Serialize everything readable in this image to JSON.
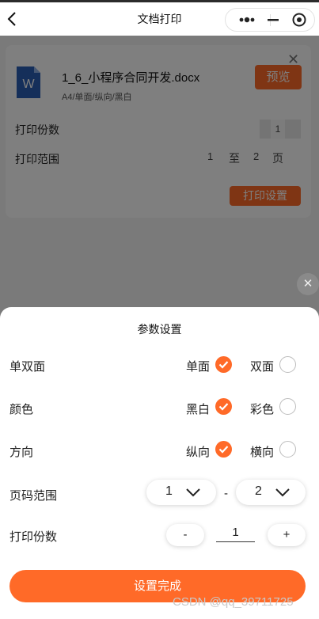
{
  "navbar": {
    "title": "文档打印",
    "back_icon": "chevron-left-icon"
  },
  "capsule": {
    "more_icon": "more-dots-icon",
    "minimize_icon": "minus-icon",
    "close_icon": "target-circle-icon"
  },
  "file_card": {
    "file_name": "1_6_小程序合同开发.docx",
    "meta": "A4/单面/纵向/黑白",
    "preview_label": "预览",
    "copies_label": "打印份数",
    "copies_value": "1",
    "range_label": "打印范围",
    "range_from": "1",
    "range_to_text": "至",
    "range_to": "2",
    "range_unit": "页",
    "print_settings_label": "打印设置"
  },
  "sheet": {
    "title": "参数设置",
    "sides": {
      "label": "单双面",
      "option_a": "单面",
      "option_b": "双面",
      "selected": "单面"
    },
    "color": {
      "label": "颜色",
      "option_a": "黑白",
      "option_b": "彩色",
      "selected": "黑白"
    },
    "orientation": {
      "label": "方向",
      "option_a": "纵向",
      "option_b": "横向",
      "selected": "纵向"
    },
    "page_range": {
      "label": "页码范围",
      "from": "1",
      "separator": "-",
      "to": "2"
    },
    "copies": {
      "label": "打印份数",
      "minus": "-",
      "value": "1",
      "plus": "+"
    },
    "done_label": "设置完成"
  },
  "watermark": "CSDN @qq_39711725",
  "colors": {
    "accent": "#ff6a28",
    "overlay": "rgba(0,0,0,0.5)"
  }
}
